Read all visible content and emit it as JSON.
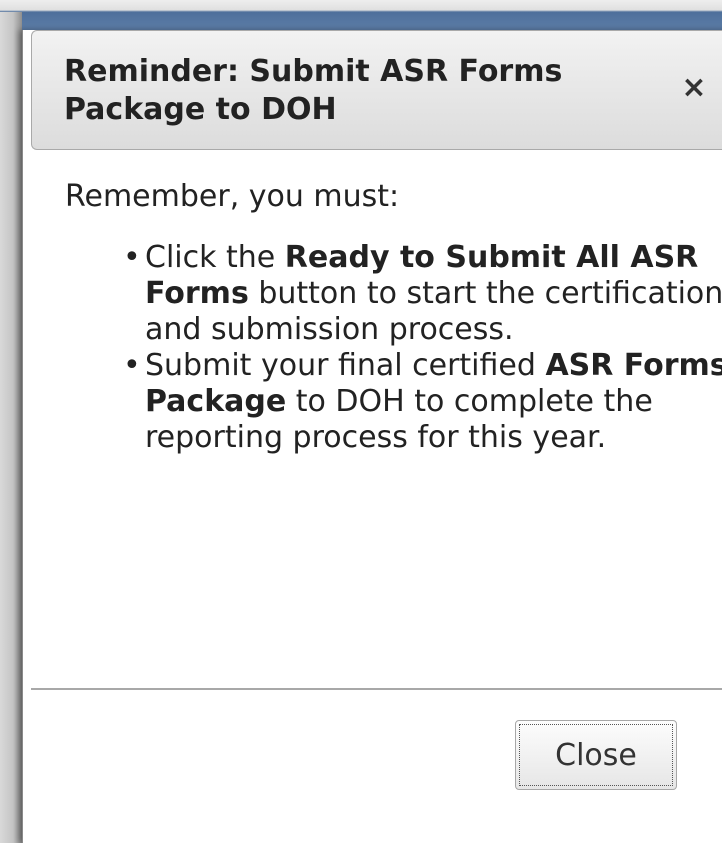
{
  "dialog": {
    "title": "Reminder: Submit ASR Forms Package to DOH",
    "close_icon": "close-icon",
    "intro": "Remember, you must:",
    "bullets": [
      {
        "pre": "Click the ",
        "bold": "Ready to Submit All ASR Forms",
        "post": " button to start the certification and submission process."
      },
      {
        "pre": "Submit your final certified ",
        "bold": "ASR Forms Package",
        "post": " to DOH to complete the reporting process for this year."
      }
    ],
    "close_button_label": "Close"
  },
  "colors": {
    "header_band": "#5d7ea8",
    "titlebar_top": "#f2f2f2",
    "titlebar_bottom": "#dcdcdc",
    "text": "#222222"
  }
}
